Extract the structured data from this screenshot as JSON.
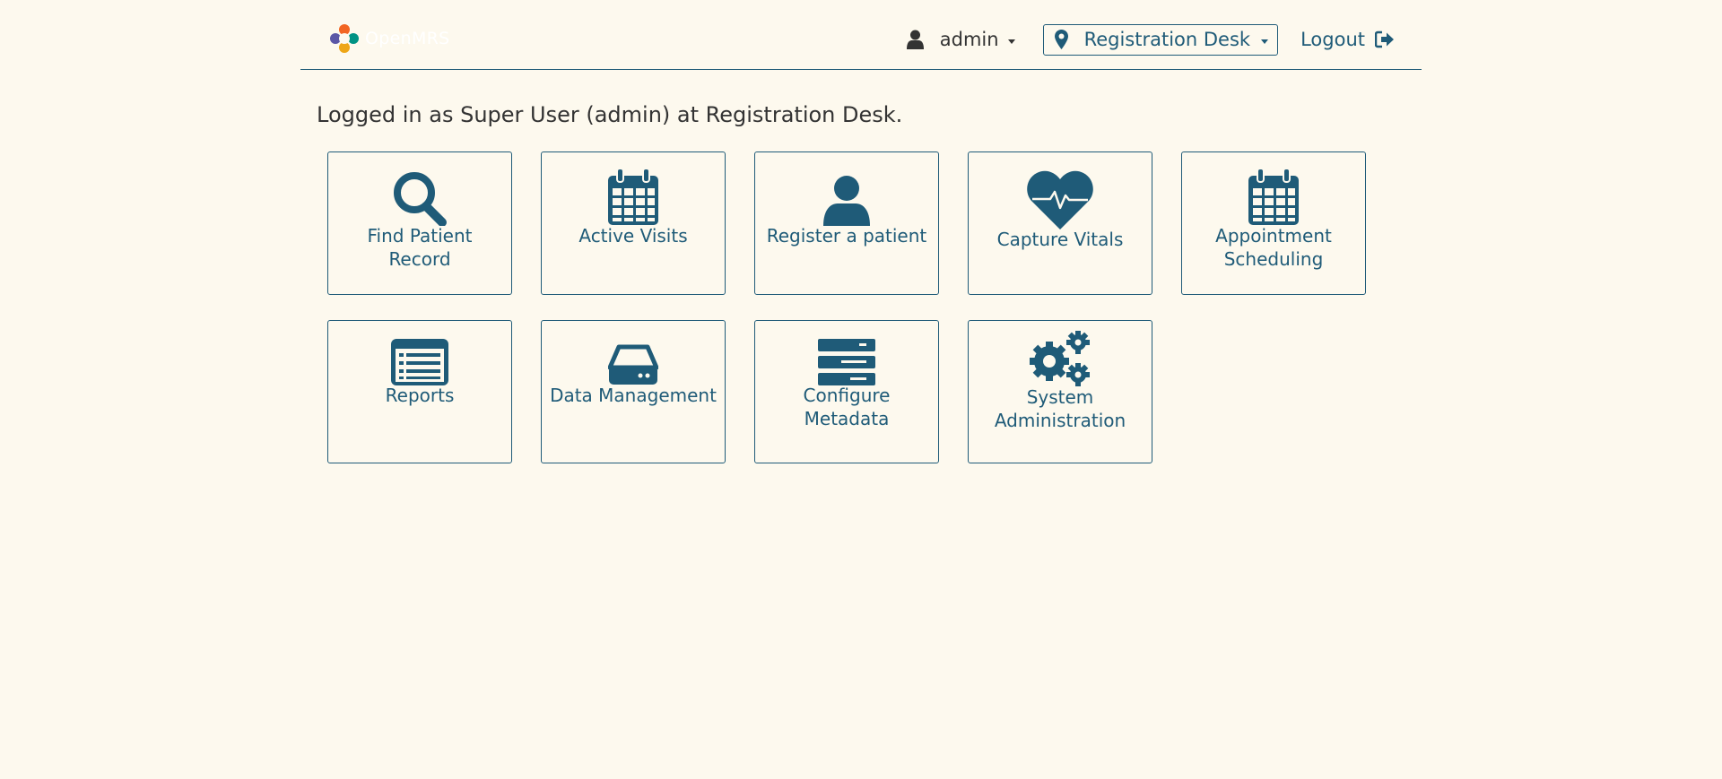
{
  "header": {
    "logo_text": "OpenMRS",
    "user": {
      "label": "admin",
      "icon": "user-icon"
    },
    "location": {
      "label": "Registration Desk",
      "icon": "map-marker-icon"
    },
    "logout": {
      "label": "Logout",
      "icon": "sign-out-icon"
    }
  },
  "welcome_text": "Logged in as Super User (admin) at Registration Desk.",
  "apps": [
    {
      "label": "Find Patient Record",
      "icon": "search-icon"
    },
    {
      "label": "Active Visits",
      "icon": "calendar-icon"
    },
    {
      "label": "Register a patient",
      "icon": "user-icon"
    },
    {
      "label": "Capture Vitals",
      "icon": "heartbeat-icon"
    },
    {
      "label": "Appointment Scheduling",
      "icon": "calendar-icon"
    },
    {
      "label": "Reports",
      "icon": "list-alt-icon"
    },
    {
      "label": "Data Management",
      "icon": "hdd-icon"
    },
    {
      "label": "Configure Metadata",
      "icon": "server-icon"
    },
    {
      "label": "System Administration",
      "icon": "cogs-icon"
    }
  ],
  "colors": {
    "background": "#fdf9ee",
    "accent": "#1f5b78",
    "text": "#333333"
  }
}
